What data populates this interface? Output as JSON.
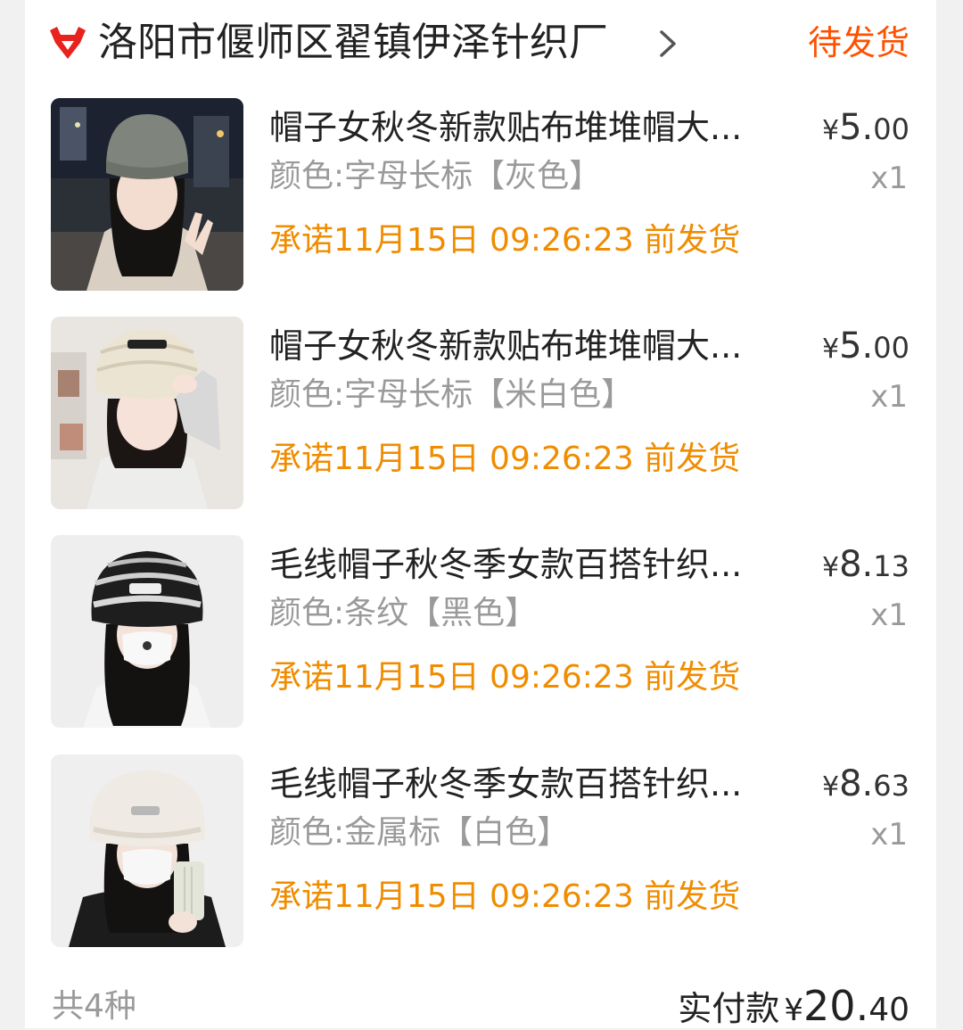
{
  "shop": {
    "name": "洛阳市偃师区翟镇伊泽针织厂",
    "logo_icon": "tmall-cat-icon",
    "chevron_icon": "chevron-right-icon",
    "status": "待发货",
    "status_color": "#ff5000"
  },
  "items": [
    {
      "title": "帽子女秋冬新款贴布堆堆帽大...",
      "sku": "颜色:字母长标【灰色】",
      "ship": "承诺11月15日 09:26:23 前发货",
      "price_symbol": "¥",
      "price_int": "5.",
      "price_dec": "00",
      "qty": "x1",
      "image_icon": "gray-knit-beanie-photo",
      "hat_color": "#7f857c"
    },
    {
      "title": "帽子女秋冬新款贴布堆堆帽大...",
      "sku": "颜色:字母长标【米白色】",
      "ship": "承诺11月15日 09:26:23 前发货",
      "price_symbol": "¥",
      "price_int": "5.",
      "price_dec": "00",
      "qty": "x1",
      "image_icon": "cream-knit-beanie-photo",
      "hat_color": "#ece4d3"
    },
    {
      "title": "毛线帽子秋冬季女款百搭针织...",
      "sku": "颜色:条纹【黑色】",
      "ship": "承诺11月15日 09:26:23 前发货",
      "price_symbol": "¥",
      "price_int": "8.",
      "price_dec": "13",
      "qty": "x1",
      "image_icon": "black-striped-fur-hat-photo",
      "hat_color": "#1e1e1e"
    },
    {
      "title": "毛线帽子秋冬季女款百搭针织...",
      "sku": "颜色:金属标【白色】",
      "ship": "承诺11月15日 09:26:23 前发货",
      "price_symbol": "¥",
      "price_int": "8.",
      "price_dec": "63",
      "qty": "x1",
      "image_icon": "white-fur-hat-photo",
      "hat_color": "#efeae3"
    }
  ],
  "footer": {
    "kind_count": "共4种",
    "total_label": "实付款",
    "total_symbol": "¥",
    "total_int": "20.",
    "total_dec": "40"
  }
}
